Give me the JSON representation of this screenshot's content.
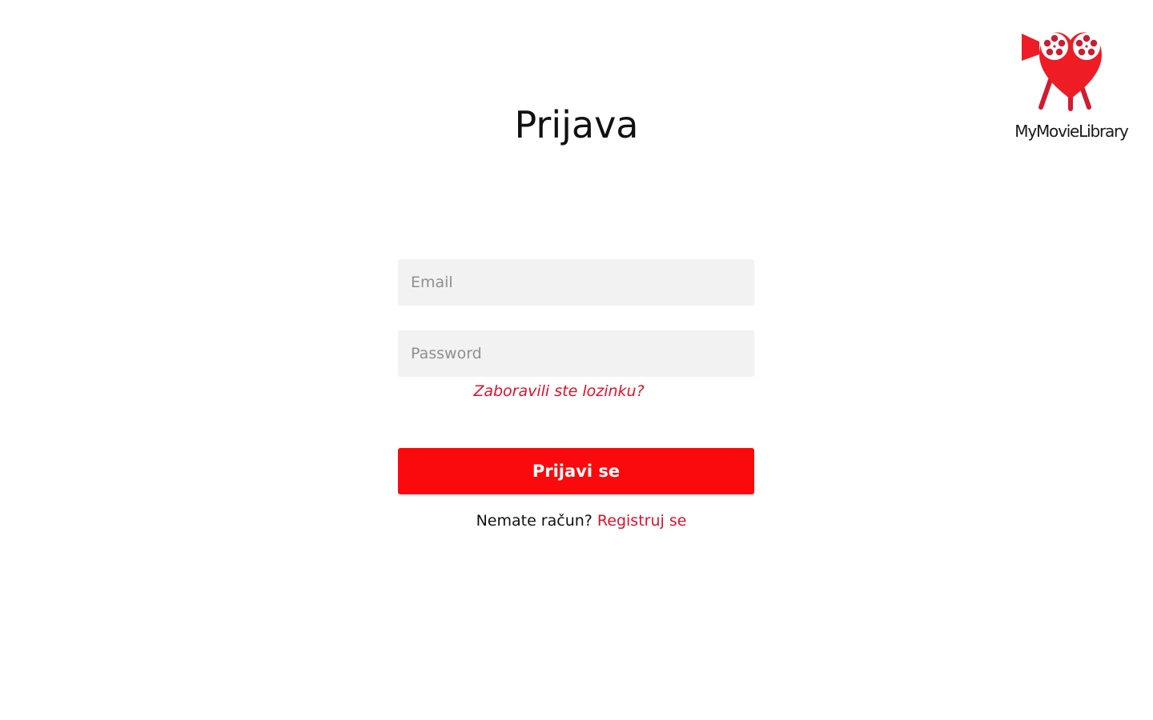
{
  "brand": {
    "name": "MyMovieLibrary",
    "logo_icon": "heart-film-reel-camera-icon",
    "primary_color": "#fa0a0c",
    "accent_color": "#e0102a"
  },
  "page": {
    "title": "Prijava"
  },
  "form": {
    "email_placeholder": "Email",
    "email_value": "",
    "password_placeholder": "Password",
    "password_value": "",
    "forgot_password": "Zaboravili ste lozinku?",
    "submit_label": "Prijavi se",
    "no_account_text": "Nemate račun?",
    "register_link": "Registruj se"
  }
}
